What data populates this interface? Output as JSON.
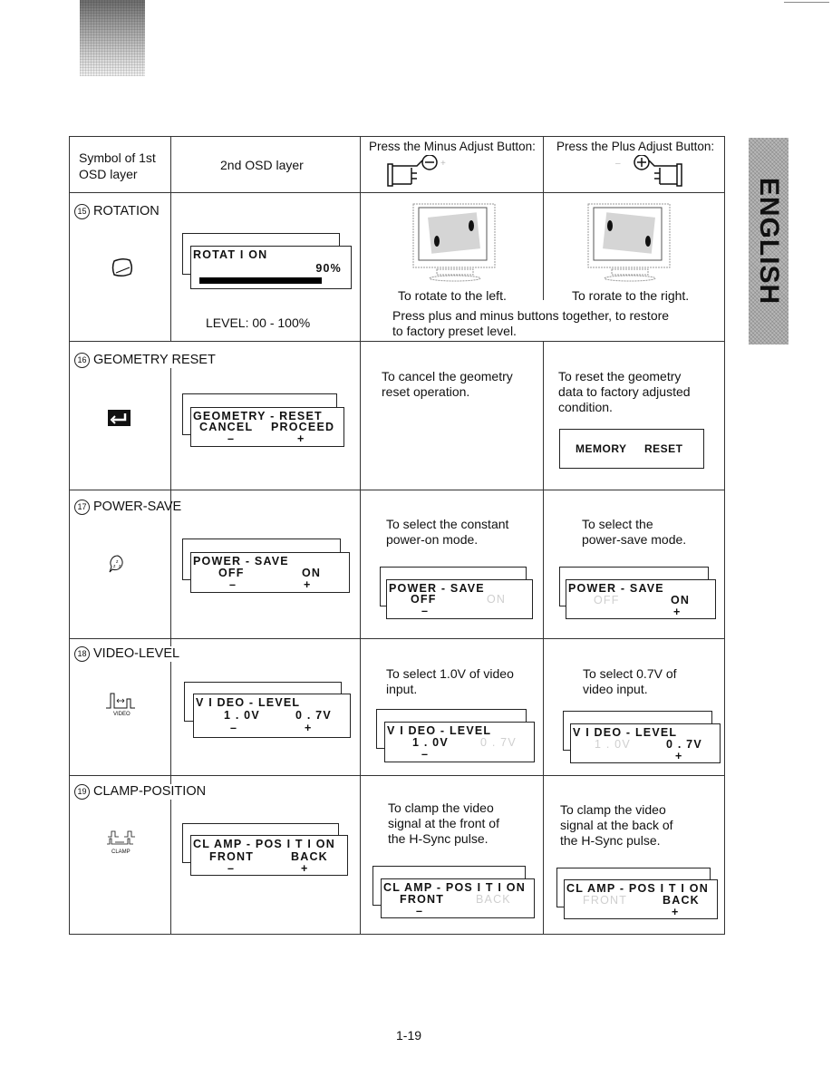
{
  "side_tab": {
    "label": "ENGLISH"
  },
  "page_number": "1-19",
  "header": {
    "col1": [
      "Symbol of 1st",
      "OSD layer"
    ],
    "col2": "2nd OSD layer",
    "col3": "Press the Minus Adjust Button:",
    "col4": "Press the Plus Adjust Button:",
    "minus_icon": "hand-pressing-minus-icon",
    "plus_icon": "hand-pressing-plus-icon"
  },
  "rows": [
    {
      "num": "15",
      "title": "ROTATION",
      "icon": "rotation-icon",
      "osd": {
        "title": "ROTAT I ON",
        "value": "90%",
        "progress_percent": 90
      },
      "note": "LEVEL: 00 - 100%",
      "minus_desc": "To rotate to the left.",
      "plus_desc": "To rorate to the right.",
      "shared_desc": [
        "Press plus and minus buttons together, to restore",
        "to factory preset level."
      ]
    },
    {
      "num": "16",
      "title": "GEOMETRY RESET",
      "icon": "geometry-reset-icon",
      "osd": {
        "title": "GEOMETRY - RESET",
        "left": "CANCEL",
        "right": "PROCEED",
        "minus": "–",
        "plus": "+"
      },
      "minus_desc": [
        "To cancel the geometry",
        "reset operation."
      ],
      "plus_desc": [
        "To reset the geometry",
        "data to factory adjusted",
        "condition."
      ],
      "plus_box": {
        "left": "MEMORY",
        "right": "RESET"
      }
    },
    {
      "num": "17",
      "title": "POWER-SAVE",
      "icon": "power-save-icon",
      "osd": {
        "title": "POWER - SAVE",
        "left": "OFF",
        "right": "ON",
        "minus": "–",
        "plus": "+"
      },
      "minus_desc": [
        "To select the constant",
        "power-on mode."
      ],
      "plus_desc": [
        "To select the",
        "power-save mode."
      ]
    },
    {
      "num": "18",
      "title": "VIDEO-LEVEL",
      "icon": "video-level-icon",
      "icon_label": "VIDEO",
      "osd": {
        "title": "V I DEO - LEVEL",
        "left": "1 . 0V",
        "right": "0 . 7V",
        "minus": "–",
        "plus": "+"
      },
      "minus_desc": [
        "To select 1.0V of video",
        "input."
      ],
      "plus_desc": [
        "To select 0.7V of",
        "video input."
      ]
    },
    {
      "num": "19",
      "title": "CLAMP-POSITION",
      "icon": "clamp-position-icon",
      "icon_label": "CLAMP",
      "osd": {
        "title": "CL AMP - POS I T I ON",
        "left": "FRONT",
        "right": "BACK",
        "minus": "–",
        "plus": "+"
      },
      "minus_desc": [
        "To clamp the video",
        "signal at the front of",
        "the H-Sync pulse."
      ],
      "plus_desc": [
        "To clamp the video",
        "signal at the back of",
        "the H-Sync pulse."
      ]
    }
  ]
}
